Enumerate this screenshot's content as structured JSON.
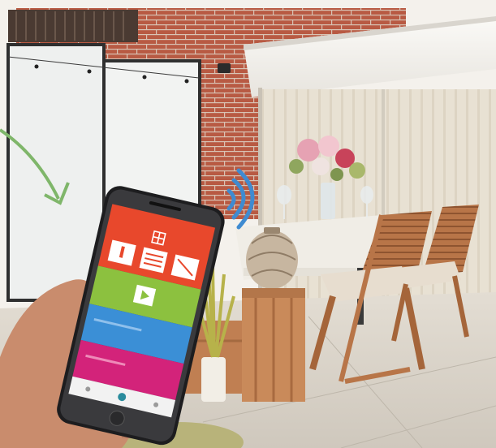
{
  "photo": {
    "subject": "smartphone-home-automation-patio",
    "colors": {
      "sky": "#f4f1ec",
      "brick": "#b85a43",
      "glass_panel": "#eef0ef",
      "frame": "#2f2f2f",
      "awning": "#f3f1ec",
      "curtain": "#e8e1d3",
      "floor": "#d9d4cb",
      "wood": "#b87548",
      "wicker_pot": "#c7b6a0",
      "grass_plant": "#b7b24a",
      "arrow": "#7fb66a",
      "wifi": "#3f8bd1",
      "skin": "#c98c6d"
    }
  },
  "phone_app": {
    "header_label": "",
    "panels": [
      {
        "name": "orange-panel",
        "color": "#e8482c"
      },
      {
        "name": "green-panel",
        "color": "#8cc13f"
      },
      {
        "name": "blue-panel",
        "color": "#3b8fd6"
      },
      {
        "name": "magenta-panel",
        "color": "#d3237a"
      },
      {
        "name": "nav-bar",
        "color": "#f2f2f2"
      }
    ],
    "tile_icons": [
      "thermometer-icon",
      "blinds-icon",
      "shade-icon"
    ],
    "play_icon": "play-icon"
  }
}
